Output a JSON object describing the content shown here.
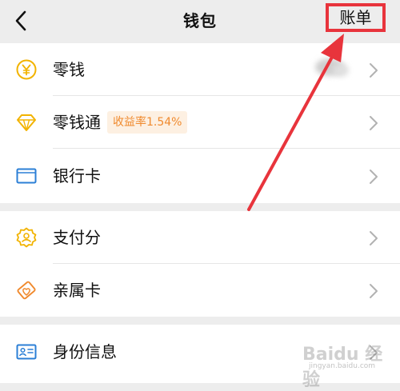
{
  "header": {
    "title": "钱包",
    "bill_label": "账单"
  },
  "group1": [
    {
      "label": "零钱",
      "icon": "yen-coin-icon"
    },
    {
      "label": "零钱通",
      "icon": "diamond-icon",
      "badge": "收益率1.54%"
    },
    {
      "label": "银行卡",
      "icon": "bank-card-icon"
    }
  ],
  "group2": [
    {
      "label": "支付分",
      "icon": "payscore-badge-icon"
    },
    {
      "label": "亲属卡",
      "icon": "family-card-icon"
    }
  ],
  "group3": [
    {
      "label": "身份信息",
      "icon": "id-card-icon"
    }
  ],
  "watermark": {
    "logo": "Baidu 经验",
    "url": "jingyan.baidu.com"
  },
  "colors": {
    "background": "#ededed",
    "row_background": "#ffffff",
    "annotation_red": "#e8343c",
    "icon_gold": "#f2b300",
    "icon_blue": "#2b7fd6",
    "badge_text": "#f08a2e",
    "badge_bg": "#fdf0e2"
  }
}
